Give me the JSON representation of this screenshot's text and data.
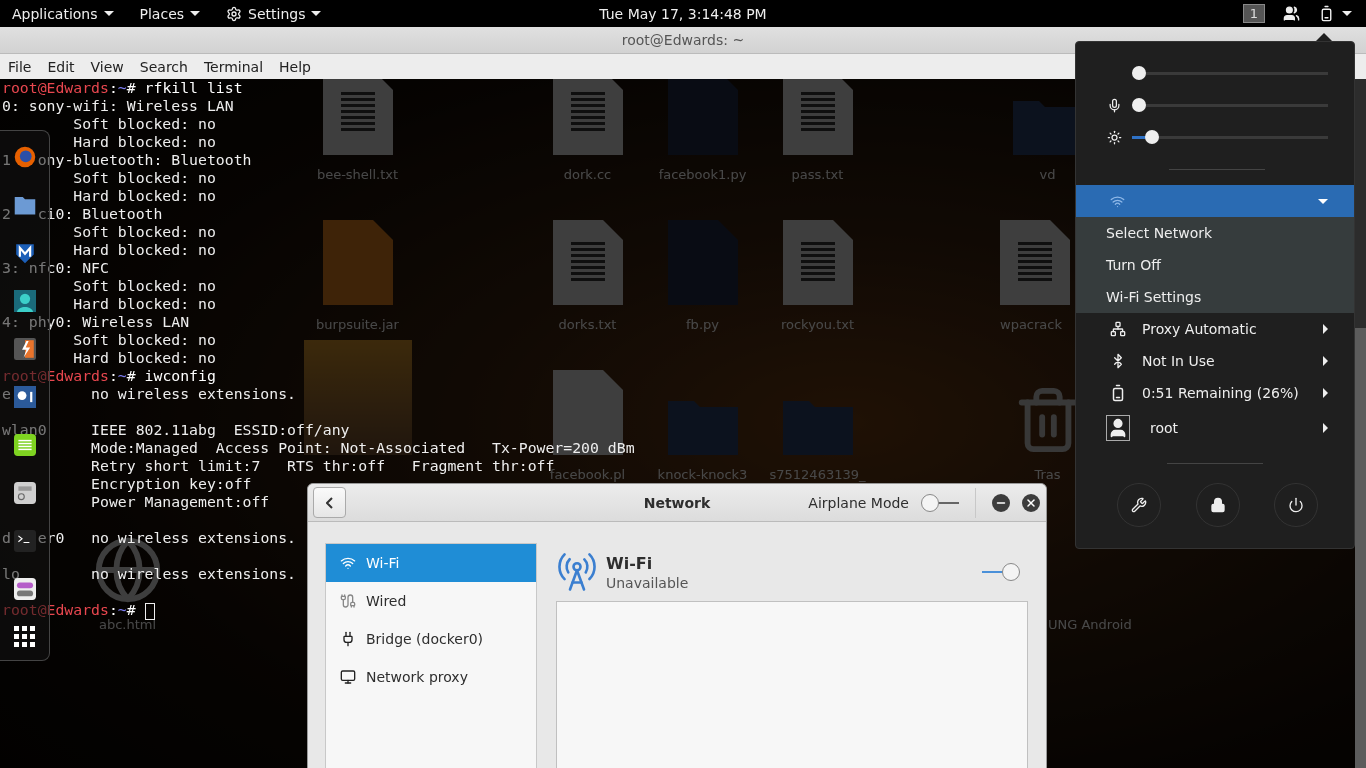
{
  "top_bar": {
    "menus": [
      {
        "label": "Applications",
        "kind": "plain"
      },
      {
        "label": "Places",
        "kind": "plain"
      },
      {
        "label": "Settings",
        "kind": "with_icon"
      }
    ],
    "clock": "Tue May 17,  3:14:48 PM",
    "workspace": "1"
  },
  "desktop_icons": [
    {
      "label": "bee-shell.txt",
      "kind": "document"
    },
    {
      "label": "dork.cc",
      "kind": "document"
    },
    {
      "label": "facebook1.py",
      "kind": "python"
    },
    {
      "label": "pass.txt",
      "kind": "document"
    },
    {
      "label": "vd",
      "kind": "folder"
    },
    {
      "label": "burpsuite.jar",
      "kind": "java"
    },
    {
      "label": "dorks.txt",
      "kind": "document"
    },
    {
      "label": "fb.py",
      "kind": "python"
    },
    {
      "label": "rockyou.txt",
      "kind": "document"
    },
    {
      "label": "wpacrack",
      "kind": "document"
    },
    {
      "kind": "photo"
    },
    {
      "label": "facebook.pl",
      "kind": "script"
    },
    {
      "label": "knock-knock3",
      "kind": "folder"
    },
    {
      "label": "s7512463139_",
      "kind": "folder"
    },
    {
      "label": "Tras",
      "kind": "trash"
    },
    {
      "label": "abc.html",
      "kind": "web"
    },
    {
      "label": "UNG Android",
      "kind": "app"
    }
  ],
  "terminal": {
    "title": "root@Edwards: ~",
    "menu": [
      "File",
      "Edit",
      "View",
      "Search",
      "Terminal",
      "Help"
    ],
    "lines": [
      {
        "kind": "prompt",
        "parts": [
          {
            "text": "root@Edwards",
            "color": "#e8474f"
          },
          {
            "text": ":",
            "color": "#ffffff"
          },
          {
            "text": "~",
            "color": "#7c7cf0"
          },
          {
            "text": "# rfkill list",
            "color": "#ffffff"
          }
        ]
      },
      {
        "kind": "output",
        "text": "0: sony-wifi: Wireless LAN"
      },
      {
        "kind": "output",
        "text": "        Soft blocked: no"
      },
      {
        "kind": "output",
        "text": "        Hard blocked: no"
      },
      {
        "kind": "output",
        "text": "1   ony-bluetooth: Bluetooth"
      },
      {
        "kind": "output",
        "text": "        Soft blocked: no"
      },
      {
        "kind": "output",
        "text": "        Hard blocked: no"
      },
      {
        "kind": "output",
        "text": "2   ci0: Bluetooth"
      },
      {
        "kind": "output",
        "text": "        Soft blocked: no"
      },
      {
        "kind": "output",
        "text": "        Hard blocked: no"
      },
      {
        "kind": "output",
        "text": "3: nfc0: NFC"
      },
      {
        "kind": "output",
        "text": "        Soft blocked: no"
      },
      {
        "kind": "output",
        "text": "        Hard blocked: no"
      },
      {
        "kind": "output",
        "text": "4: phy0: Wireless LAN"
      },
      {
        "kind": "output",
        "text": "        Soft blocked: no"
      },
      {
        "kind": "output",
        "text": "        Hard blocked: no"
      },
      {
        "kind": "prompt",
        "parts": [
          {
            "text": "root@Edwards",
            "color": "#e8474f"
          },
          {
            "text": ":",
            "color": "#ffffff"
          },
          {
            "text": "~",
            "color": "#7c7cf0"
          },
          {
            "text": "# iwconfig",
            "color": "#ffffff"
          }
        ]
      },
      {
        "kind": "output",
        "text": "e         no wireless extensions."
      },
      {
        "kind": "blank"
      },
      {
        "kind": "output",
        "text": "wlan0     IEEE 802.11abg  ESSID:off/any"
      },
      {
        "kind": "output",
        "text": "          Mode:Managed  Access Point: Not-Associated   Tx-Power=200 dBm"
      },
      {
        "kind": "output",
        "text": "          Retry short limit:7   RTS thr:off   Fragment thr:off"
      },
      {
        "kind": "output",
        "text": "          Encryption key:off"
      },
      {
        "kind": "output",
        "text": "          Power Management:off"
      },
      {
        "kind": "blank"
      },
      {
        "kind": "output",
        "text": "d   er0   no wireless extensions."
      },
      {
        "kind": "blank"
      },
      {
        "kind": "output",
        "text": "lo        no wireless extensions."
      },
      {
        "kind": "blank"
      },
      {
        "kind": "prompt",
        "cursor": true,
        "parts": [
          {
            "text": "root@Edwards",
            "color": "#e8474f"
          },
          {
            "text": ":",
            "color": "#ffffff"
          },
          {
            "text": "~",
            "color": "#7c7cf0"
          },
          {
            "text": "#",
            "color": "#ffffff"
          }
        ]
      }
    ]
  },
  "dock": [
    {
      "kind": "browser"
    },
    {
      "kind": "folder"
    },
    {
      "kind": "shield"
    },
    {
      "kind": "avatar"
    },
    {
      "kind": "burp"
    },
    {
      "kind": "blue_app"
    },
    {
      "kind": "notes"
    },
    {
      "kind": "tool"
    },
    {
      "kind": "terminal"
    },
    {
      "kind": "toggles"
    },
    {
      "kind": "grid"
    }
  ],
  "network_window": {
    "title": "Network",
    "airplane_mode": {
      "label": "Airplane Mode",
      "on": false
    },
    "sidebar": [
      {
        "label": "Wi-Fi",
        "kind": "wifi",
        "selected": true
      },
      {
        "label": "Wired",
        "kind": "wired",
        "selected": false
      },
      {
        "label": "Bridge (docker0)",
        "kind": "bridge",
        "selected": false
      },
      {
        "label": "Network proxy",
        "kind": "proxy",
        "selected": false
      }
    ],
    "device": {
      "name": "Wi-Fi",
      "status": "Unavailable",
      "on": true
    }
  },
  "system_menu": {
    "sliders": [
      {
        "kind": "volume",
        "level": 0
      },
      {
        "kind": "microphone",
        "level": 0
      },
      {
        "kind": "brightness",
        "level": 0.07
      }
    ],
    "wifi": {
      "expanded": true,
      "items": [
        "Select Network",
        "Turn Off",
        "Wi-Fi Settings"
      ]
    },
    "rows": [
      {
        "kind": "proxy",
        "label": "Proxy Automatic"
      },
      {
        "kind": "bluetooth",
        "label": "Not In Use"
      },
      {
        "kind": "battery",
        "label": "0:51 Remaining (26%)"
      },
      {
        "kind": "user",
        "label": "root"
      }
    ],
    "buttons": [
      {
        "kind": "settings"
      },
      {
        "kind": "lock"
      },
      {
        "kind": "power"
      }
    ]
  }
}
